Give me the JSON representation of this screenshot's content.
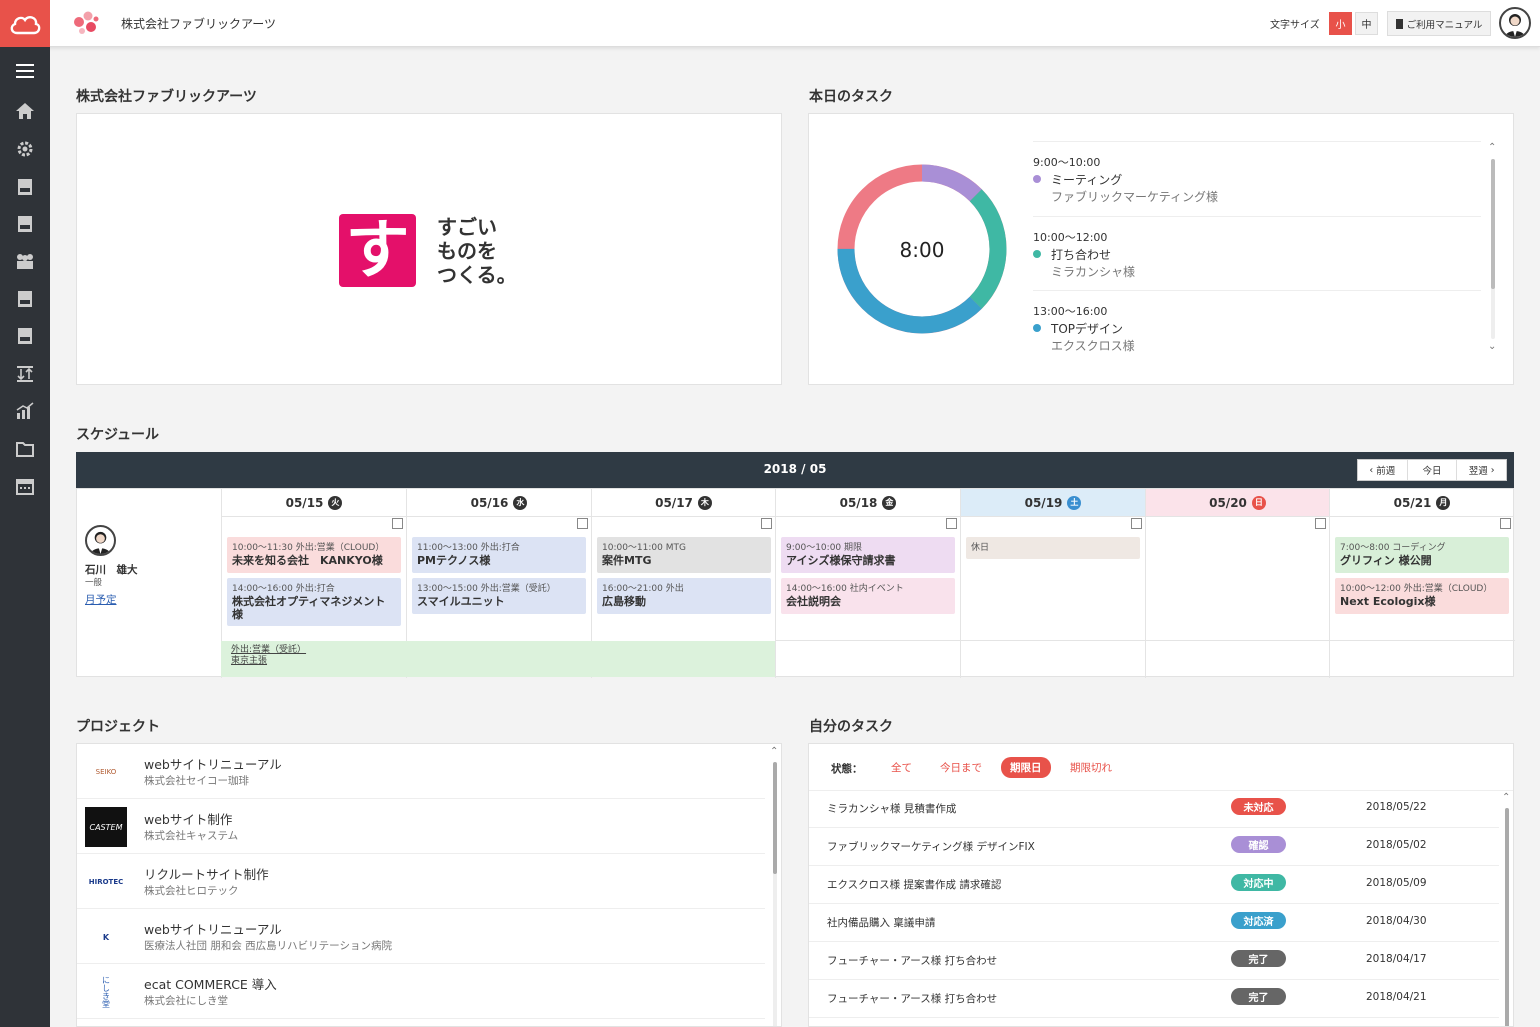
{
  "header": {
    "company_name": "株式会社ファブリックアーツ",
    "font_size_label": "文字サイズ",
    "font_size_small": "小",
    "font_size_mid": "中",
    "manual_label": "ご利用マニュアル"
  },
  "sidebar": {
    "icons": [
      "menu-icon",
      "home-icon",
      "gear-icon",
      "app-doc-icon",
      "list-doc-icon",
      "users-icon",
      "tiles-doc-icon",
      "doc-icon",
      "sort-icon",
      "chart-icon",
      "folder-icon",
      "calendar-icon"
    ]
  },
  "company_section": {
    "title": "株式会社ファブリックアーツ",
    "logo_char": "す",
    "slogan_lines": [
      "すごい",
      "ものを",
      "つくる。"
    ]
  },
  "today_tasks": {
    "title": "本日のタスク",
    "total": "8:00",
    "colors": {
      "meeting": "#a98fd6",
      "uchiawase": "#3fb8a4",
      "design": "#3aa0cc",
      "rest": "#ee7a85"
    },
    "items": [
      {
        "time": "9:00〜10:00",
        "name": "ミーティング",
        "client": "ファブリックマーケティング様",
        "color": "#a98fd6"
      },
      {
        "time": "10:00〜12:00",
        "name": "打ち合わせ",
        "client": "ミラカンシャ様",
        "color": "#3fb8a4"
      },
      {
        "time": "13:00〜16:00",
        "name": "TOPデザイン",
        "client": "エクスクロス様",
        "color": "#3aa0cc"
      }
    ]
  },
  "schedule": {
    "title": "スケジュール",
    "month": "2018 / 05",
    "nav": {
      "prev": "前週",
      "today": "今日",
      "next": "翌週"
    },
    "user": {
      "name": "石川　雄大",
      "role": "一般",
      "link": "月予定"
    },
    "days": [
      {
        "date": "05/15",
        "dow": "火"
      },
      {
        "date": "05/16",
        "dow": "水"
      },
      {
        "date": "05/17",
        "dow": "木"
      },
      {
        "date": "05/18",
        "dow": "金"
      },
      {
        "date": "05/19",
        "dow": "土"
      },
      {
        "date": "05/20",
        "dow": "日"
      },
      {
        "date": "05/21",
        "dow": "月"
      }
    ],
    "events": {
      "d0": [
        {
          "time": "10:00〜11:30 外出:営業（CLOUD）",
          "name": "未来を知る会社　KANKYO様"
        },
        {
          "time": "14:00〜16:00 外出:打合",
          "name": "株式会社オプティマネジメント様"
        }
      ],
      "d1": [
        {
          "time": "11:00〜13:00 外出:打合",
          "name": "PMテクノス様"
        },
        {
          "time": "13:00〜15:00 外出:営業（受託）",
          "name": "スマイルユニット"
        }
      ],
      "d2": [
        {
          "time": "10:00〜11:00 MTG",
          "name": "案件MTG"
        },
        {
          "time": "16:00〜21:00 外出",
          "name": "広島移動"
        }
      ],
      "d3": [
        {
          "time": "9:00〜10:00 期限",
          "name": "アイシズ様保守請求書"
        },
        {
          "time": "14:00〜16:00 社内イベント",
          "name": "会社説明会"
        }
      ],
      "d4": [
        {
          "time": "休日",
          "name": ""
        }
      ],
      "d6": [
        {
          "time": "7:00〜8:00 コーディング",
          "name": "グリフィン 様公開"
        },
        {
          "time": "10:00〜12:00 外出:営業（CLOUD）",
          "name": "Next Ecologix様"
        }
      ]
    },
    "allday": {
      "line1": "外出:営業（受託）",
      "line2": "東京主張"
    }
  },
  "projects": {
    "title": "プロジェクト",
    "items": [
      {
        "name": "webサイトリニューアル",
        "client": "株式会社セイコー珈琲",
        "logo": "SEIKO"
      },
      {
        "name": "webサイト制作",
        "client": "株式会社キャステム",
        "logo": "CASTEM"
      },
      {
        "name": "リクルートサイト制作",
        "client": "株式会社ヒロテック",
        "logo": "HIROTEC"
      },
      {
        "name": "webサイトリニューアル",
        "client": "医療法人社団 朋和会 西広島リハビリテーション病院",
        "logo": "K"
      },
      {
        "name": "ecat COMMERCE 導入",
        "client": "株式会社にしき堂",
        "logo": "にしき堂"
      }
    ]
  },
  "my_tasks": {
    "title": "自分のタスク",
    "filter_label": "状態：",
    "filters": [
      "全て",
      "今日まで",
      "期限日",
      "期限切れ"
    ],
    "items": [
      {
        "name": "ミラカンシャ様 見積書作成",
        "status": "未対応",
        "color": "#e8524a",
        "date": "2018/05/22"
      },
      {
        "name": "ファブリックマーケティング様 デザインFIX",
        "status": "確認",
        "color": "#a98fd6",
        "date": "2018/05/02"
      },
      {
        "name": "エクスクロス様 提案書作成 請求確認",
        "status": "対応中",
        "color": "#3fb8a4",
        "date": "2018/05/09"
      },
      {
        "name": "社内備品購入 稟議申請",
        "status": "対応済",
        "color": "#3aa0cc",
        "date": "2018/04/30"
      },
      {
        "name": "フューチャー・アース様 打ち合わせ",
        "status": "完了",
        "color": "#666666",
        "date": "2018/04/17"
      },
      {
        "name": "フューチャー・アース様 打ち合わせ",
        "status": "完了",
        "color": "#666666",
        "date": "2018/04/21"
      }
    ]
  }
}
